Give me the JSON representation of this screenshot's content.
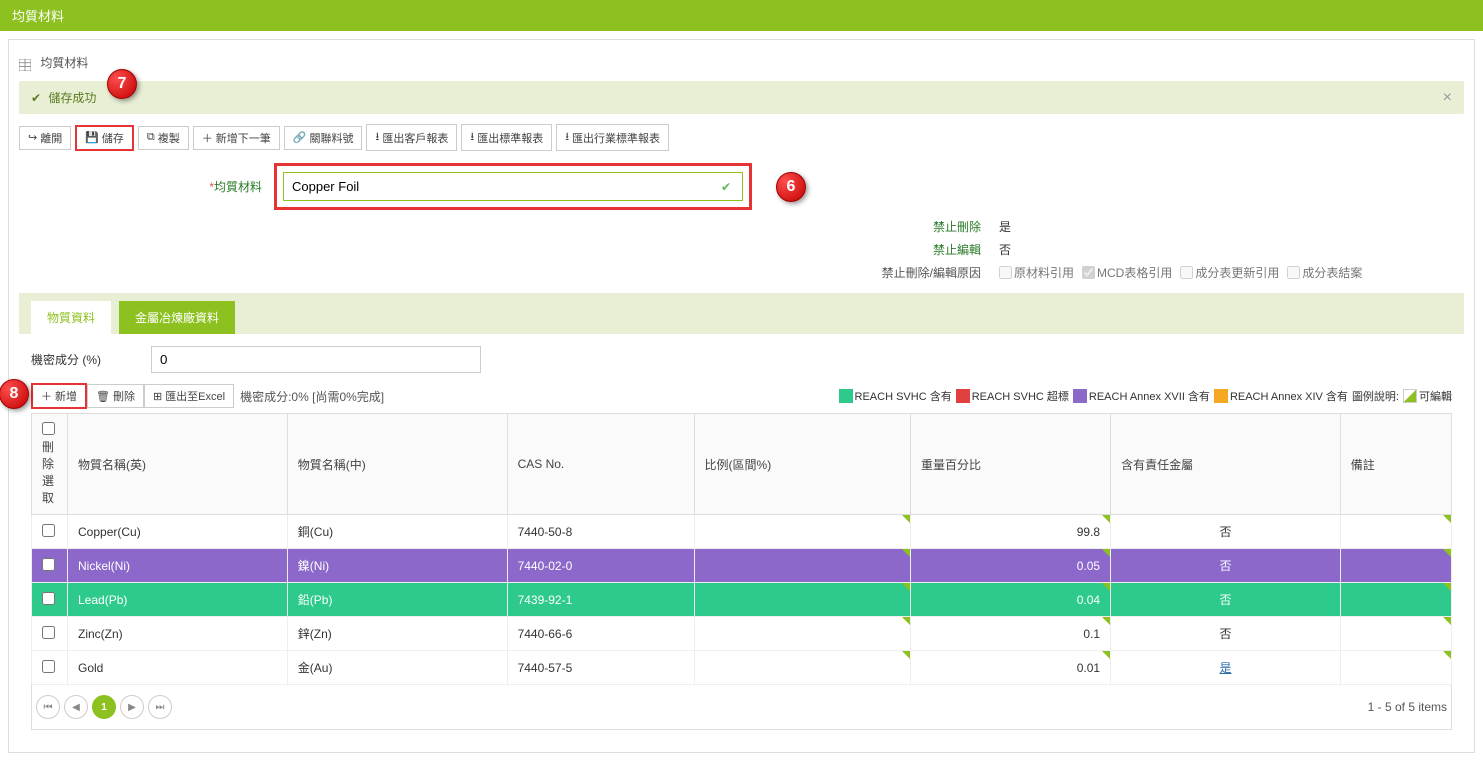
{
  "header": {
    "title": "均質材料"
  },
  "panel": {
    "title": "均質材料"
  },
  "alert": {
    "message": "儲存成功",
    "code": "7"
  },
  "toolbar": {
    "leave": "離開",
    "save": "儲存",
    "copy": "複製",
    "add_next": "新增下一筆",
    "link_partno": "關聯料號",
    "export_customer": "匯出客戶報表",
    "export_standard": "匯出標準報表",
    "export_industry": "匯出行業標準報表"
  },
  "form": {
    "material_label": "均質材料",
    "material_value": "Copper Foil",
    "callout_material": "6",
    "forbid_delete_label": "禁止刪除",
    "forbid_delete_value": "是",
    "forbid_edit_label": "禁止編輯",
    "forbid_edit_value": "否",
    "reason_label": "禁止刪除/編輯原因",
    "reason_opts": {
      "raw_ref": "原材料引用",
      "mcd_ref": "MCD表格引用",
      "composition_update_ref": "成分表更新引用",
      "composition_result": "成分表結案"
    }
  },
  "tabs": {
    "substance": "物質資料",
    "smelter": "金屬冶煉廠資料"
  },
  "density": {
    "label": "機密成分 (%)",
    "value": "0"
  },
  "grid_toolbar": {
    "add": "新增",
    "delete": "刪除",
    "export_excel": "匯出至Excel",
    "status": "機密成分:0% [尚需0%完成]",
    "callout_add": "8"
  },
  "legend": {
    "svhc": "REACH SVHC 含有",
    "svhc_exceed": "REACH SVHC 超標",
    "annex17": "REACH Annex XVII 含有",
    "annex14": "REACH Annex XIV 含有",
    "legend_label": "圖例說明:",
    "editable": "可編輯"
  },
  "columns": {
    "select": "刪除選取",
    "name_en": "物質名稱(英)",
    "name_zh": "物質名稱(中)",
    "cas": "CAS No.",
    "range": "比例(區間%)",
    "weight": "重量百分比",
    "conflict": "含有責任金屬",
    "remark": "備註"
  },
  "rows": [
    {
      "name_en": "Copper(Cu)",
      "name_zh": "銅(Cu)",
      "cas": "7440-50-8",
      "range": "",
      "weight": "99.8",
      "conflict": "否",
      "remark": "",
      "class": ""
    },
    {
      "name_en": "Nickel(Ni)",
      "name_zh": "鎳(Ni)",
      "cas": "7440-02-0",
      "range": "",
      "weight": "0.05",
      "conflict": "否",
      "remark": "",
      "class": "row-annex17"
    },
    {
      "name_en": "Lead(Pb)",
      "name_zh": "鉛(Pb)",
      "cas": "7439-92-1",
      "range": "",
      "weight": "0.04",
      "conflict": "否",
      "remark": "",
      "class": "row-svhc"
    },
    {
      "name_en": "Zinc(Zn)",
      "name_zh": "鋅(Zn)",
      "cas": "7440-66-6",
      "range": "",
      "weight": "0.1",
      "conflict": "否",
      "remark": "",
      "class": ""
    },
    {
      "name_en": "Gold",
      "name_zh": "金(Au)",
      "cas": "7440-57-5",
      "range": "",
      "weight": "0.01",
      "conflict": "是",
      "remark": "",
      "class": "",
      "conflict_link": true
    }
  ],
  "pager": {
    "current": "1",
    "info": "1 - 5 of 5 items"
  }
}
